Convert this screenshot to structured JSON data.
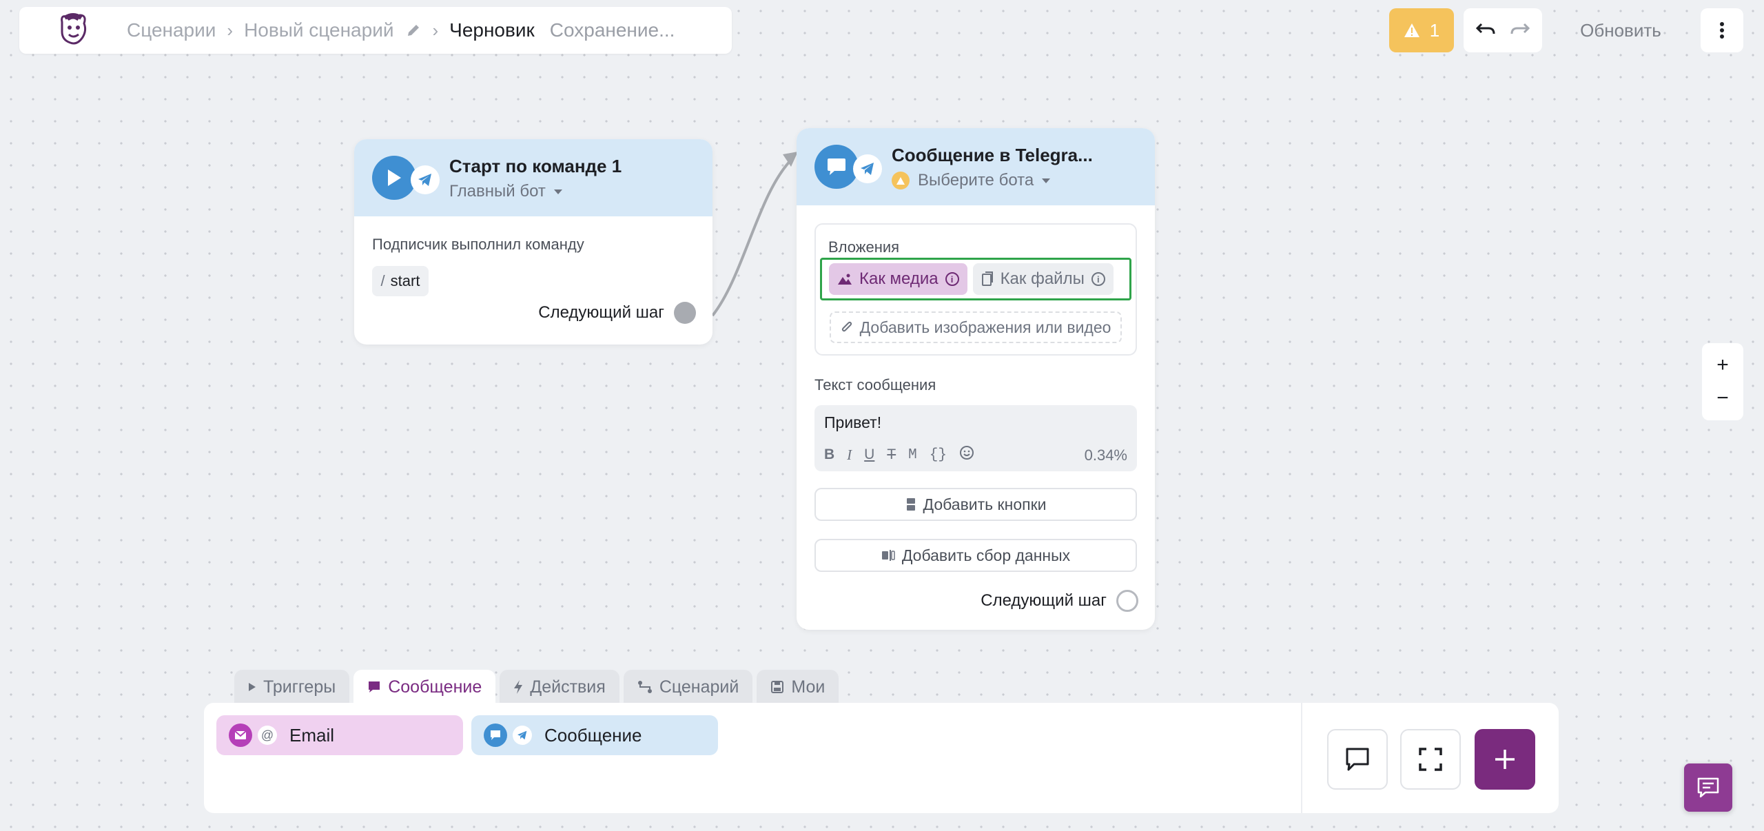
{
  "breadcrumbs": {
    "scenarios": "Сценарии",
    "new_scenario": "Новый сценарий",
    "draft": "Черновик",
    "status": "Сохранение..."
  },
  "topbar": {
    "warning_count": "1",
    "refresh_label": "Обновить"
  },
  "node_start": {
    "title": "Старт по команде 1",
    "bot": "Главный бот",
    "condition": "Подписчик выполнил команду",
    "command_prefix": "/",
    "command": "start",
    "next_step": "Следующий шаг"
  },
  "node_message": {
    "title": "Сообщение в Telegra...",
    "bot": "Выберите бота",
    "attachments_label": "Вложения",
    "as_media": "Как медиа",
    "as_files": "Как файлы",
    "add_media": "Добавить изображения или видео",
    "text_label": "Текст сообщения",
    "text": "Привет!",
    "format": {
      "bold": "B",
      "italic": "I",
      "underline": "U",
      "strike": "T",
      "mono": "M",
      "code": "{}"
    },
    "percent": "0.34%",
    "add_buttons": "Добавить кнопки",
    "add_data": "Добавить сбор данных",
    "next_step": "Следующий шаг"
  },
  "tabs": [
    {
      "label": "Триггеры"
    },
    {
      "label": "Сообщение"
    },
    {
      "label": "Действия"
    },
    {
      "label": "Сценарий"
    },
    {
      "label": "Мои"
    }
  ],
  "palette": {
    "email": "Email",
    "email_at": "@",
    "message": "Сообщение"
  },
  "zoom": {
    "in": "+",
    "out": "−"
  },
  "colors": {
    "accent": "#7a2b82",
    "warning": "#f5c35c",
    "telegram_blue": "#3f8fd2",
    "node_header": "#d6e8f7",
    "highlight_border": "#2fa44a"
  }
}
